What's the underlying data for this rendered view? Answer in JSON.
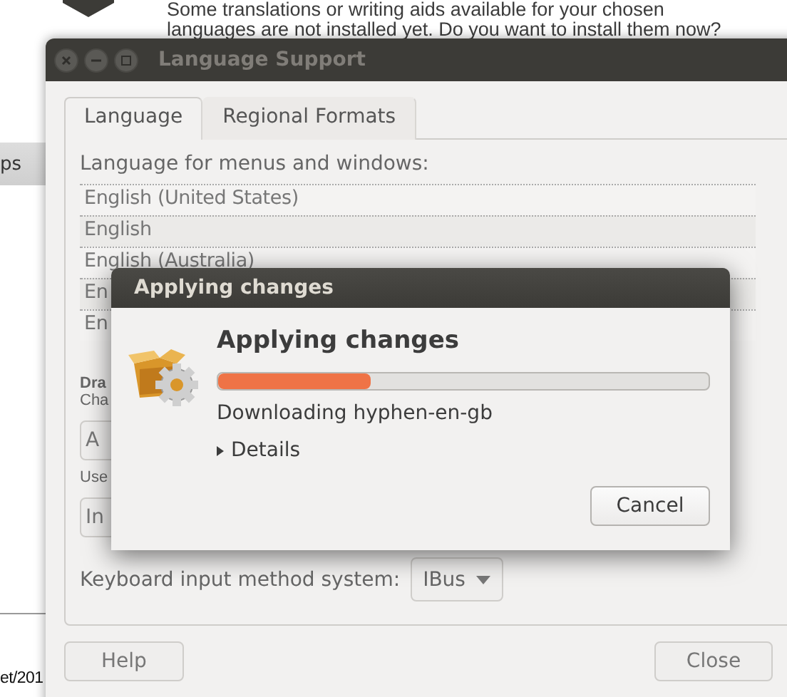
{
  "background_window": {
    "message_lines": [
      "Some translations or writing aids available for your chosen",
      "languages are not installed yet. Do you want to install them now?"
    ]
  },
  "side_window": {
    "header_fragment": "ps",
    "footer_fragment": "et/201"
  },
  "window": {
    "title": "Language Support",
    "tabs": [
      {
        "label": "Language",
        "selected": true
      },
      {
        "label": "Regional Formats",
        "selected": false
      }
    ],
    "section_label": "Language for menus and windows:",
    "languages": [
      "English (United States)",
      "English",
      "English (Australia)",
      "En",
      "En"
    ],
    "fragments": {
      "heading": "Dra",
      "caption": "Cha",
      "button_1": "A",
      "caption_2": "Use",
      "button_2": "In"
    },
    "input_method": {
      "label": "Keyboard input method system:",
      "value": "IBus"
    },
    "buttons": {
      "help": "Help",
      "close": "Close"
    }
  },
  "dialog": {
    "title": "Applying changes",
    "heading": "Applying changes",
    "progress": {
      "level": 0.31
    },
    "status": "Downloading hyphen-en-gb",
    "details": {
      "label": "Details",
      "expanded": false
    },
    "cancel": "Cancel"
  }
}
